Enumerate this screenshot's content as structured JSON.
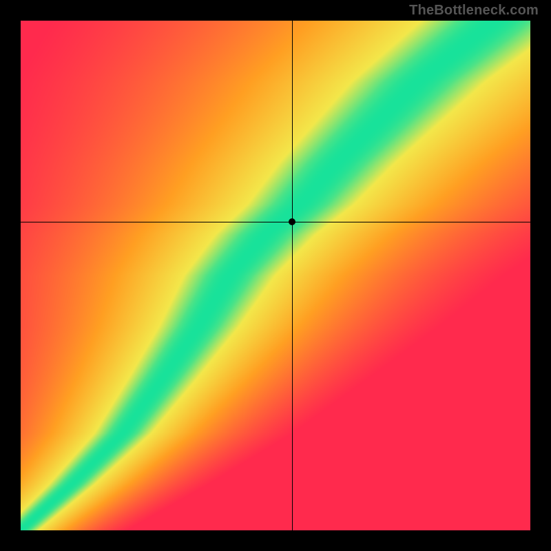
{
  "watermark": "TheBottleneck.com",
  "chart_data": {
    "type": "heatmap",
    "title": "",
    "xlabel": "",
    "ylabel": "",
    "xlim": [
      0,
      1
    ],
    "ylim": [
      0,
      1
    ],
    "crosshair": {
      "x": 0.533,
      "y": 0.605
    },
    "marker": {
      "x": 0.533,
      "y": 0.605
    },
    "optimal_curve": {
      "description": "Green optimal band center (normalized x,y pairs, y measured from bottom)",
      "points": [
        [
          0.0,
          0.0
        ],
        [
          0.1,
          0.09
        ],
        [
          0.2,
          0.19
        ],
        [
          0.28,
          0.3
        ],
        [
          0.35,
          0.4
        ],
        [
          0.41,
          0.5
        ],
        [
          0.48,
          0.58
        ],
        [
          0.55,
          0.64
        ],
        [
          0.62,
          0.72
        ],
        [
          0.7,
          0.8
        ],
        [
          0.78,
          0.88
        ],
        [
          0.88,
          0.96
        ],
        [
          0.93,
          1.0
        ]
      ],
      "band_halfwidth": 0.05
    },
    "color_stops": {
      "optimal": "#18e29a",
      "near": "#f3e74a",
      "mid": "#ff9f22",
      "far": "#ff2a4d"
    }
  }
}
